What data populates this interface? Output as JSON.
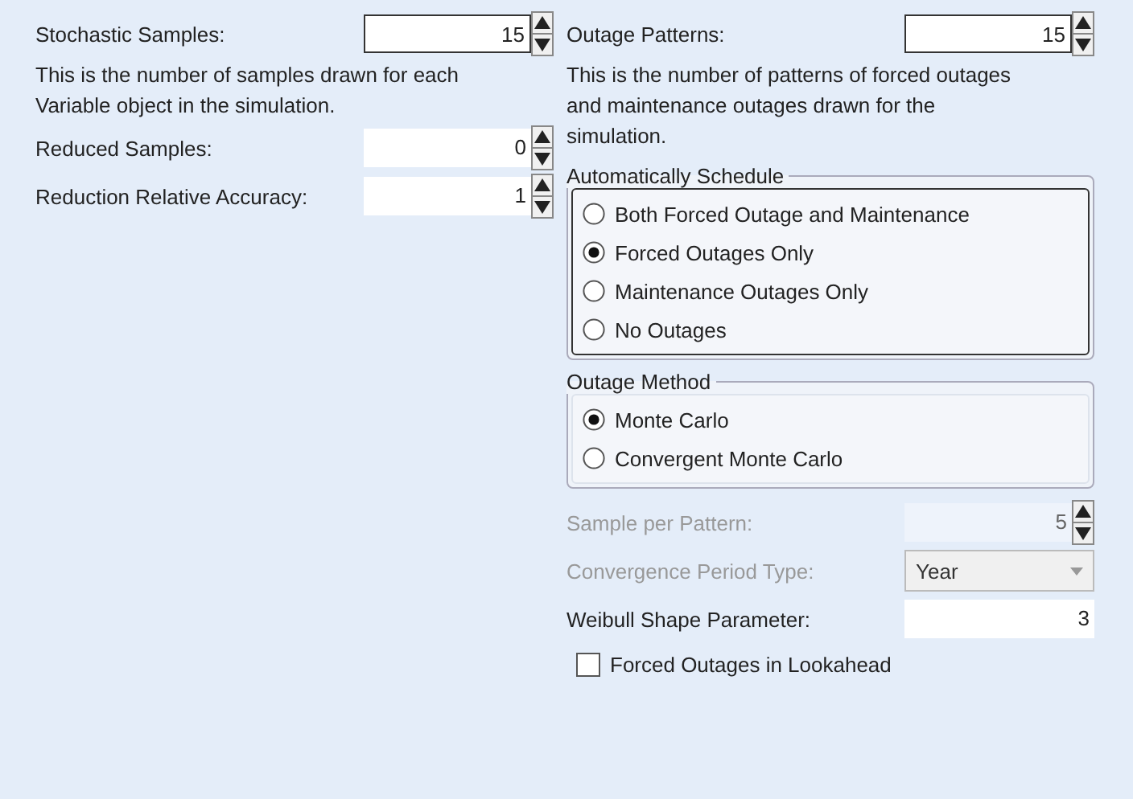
{
  "left": {
    "fields": [
      {
        "label": "Stochastic Samples:",
        "value": "15",
        "bordered": true,
        "description": "This is the number of samples drawn for each Variable object in the simulation."
      },
      {
        "label": "Reduced Samples:",
        "value": "0",
        "bordered": false
      },
      {
        "label": "Reduction Relative Accuracy:",
        "value": "1",
        "bordered": false
      }
    ]
  },
  "right": {
    "fields": [
      {
        "label": "Outage Patterns:",
        "value": "15",
        "bordered": true,
        "description": "This is the number of patterns of forced outages and maintenance outages drawn for the simulation."
      }
    ],
    "groups": [
      {
        "title": "Automatically Schedule",
        "focused": true,
        "options": [
          {
            "label": "Both Forced Outage and Maintenance",
            "selected": false
          },
          {
            "label": "Forced Outages Only",
            "selected": true
          },
          {
            "label": "Maintenance Outages Only",
            "selected": false
          },
          {
            "label": "No Outages",
            "selected": false
          }
        ]
      },
      {
        "title": "Outage Method",
        "focused": false,
        "options": [
          {
            "label": "Monte Carlo",
            "selected": true
          },
          {
            "label": "Convergent Monte Carlo",
            "selected": false
          }
        ]
      }
    ],
    "settings": [
      {
        "kind": "spinner",
        "label": "Sample per Pattern:",
        "value": "5",
        "disabled": true
      },
      {
        "kind": "dropdown",
        "label": "Convergence Period Type:",
        "value": "Year",
        "disabled": true
      },
      {
        "kind": "text",
        "label": "Weibull Shape Parameter:",
        "value": "3",
        "disabled": false
      }
    ],
    "checkbox": {
      "label": "Forced Outages in Lookahead",
      "checked": false
    }
  }
}
